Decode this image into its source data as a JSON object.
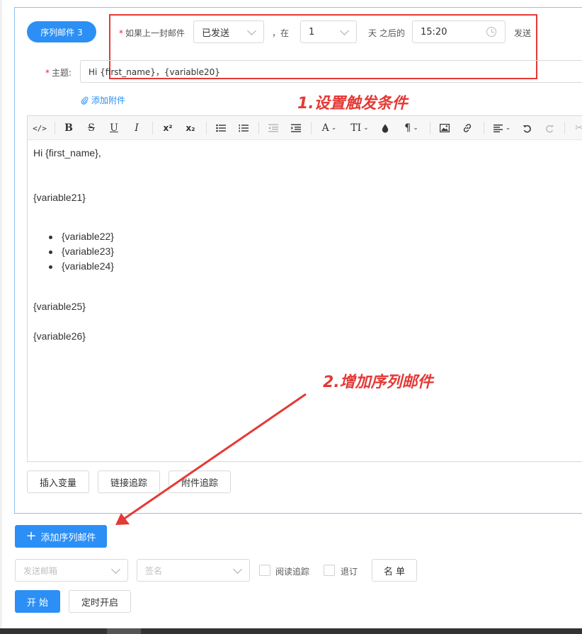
{
  "sequence": {
    "tag_label": "序列邮件 3"
  },
  "trigger": {
    "condition_label": "如果上一封邮件",
    "status_value": "已发送",
    "comma_at": "，在",
    "days_value": "1",
    "days_after_label": "天 之后的",
    "time_value": "15:20",
    "send_label": "发送"
  },
  "subject": {
    "label": "主题:",
    "value": "Hi {first_name}，{variable20}"
  },
  "attachment": {
    "label": "添加附件"
  },
  "annotations": {
    "step1": "1.设置触发条件",
    "step2": "2.增加序列邮件"
  },
  "toolbar": {
    "items": [
      "code-view",
      "bold",
      "strikethrough",
      "underline",
      "italic",
      "superscript",
      "subscript",
      "bullet-list",
      "numbered-list",
      "outdent",
      "indent",
      "font-color",
      "font-size",
      "highlight",
      "paragraph",
      "image",
      "link",
      "align",
      "undo",
      "redo",
      "cut"
    ],
    "bold": "B",
    "strike": "S",
    "underline": "U",
    "italic": "I",
    "sup": "x²",
    "sub": "x₂",
    "font": "A",
    "size": "TI",
    "para": "¶"
  },
  "editor": {
    "greeting": "Hi {first_name},",
    "para1": "{variable21}",
    "bullets": [
      "{variable22}",
      "{variable23}",
      "{variable24}"
    ],
    "para2": "{variable25}",
    "para3": "{variable26}"
  },
  "editor_buttons": {
    "insert_variable": "插入变量",
    "link_tracking": "链接追踪",
    "attachment_tracking": "附件追踪"
  },
  "add_sequence": {
    "plus": "+",
    "label": "添加序列邮件"
  },
  "send_options": {
    "sender_placeholder": "发送邮箱",
    "signature_placeholder": "签名",
    "read_tracking": "阅读追踪",
    "unsubscribe": "退订",
    "list_button": "名 单"
  },
  "actions": {
    "start": "开 始",
    "schedule": "定时开启"
  },
  "colors": {
    "primary": "#2b8ff5",
    "annotation": "#e53935"
  }
}
